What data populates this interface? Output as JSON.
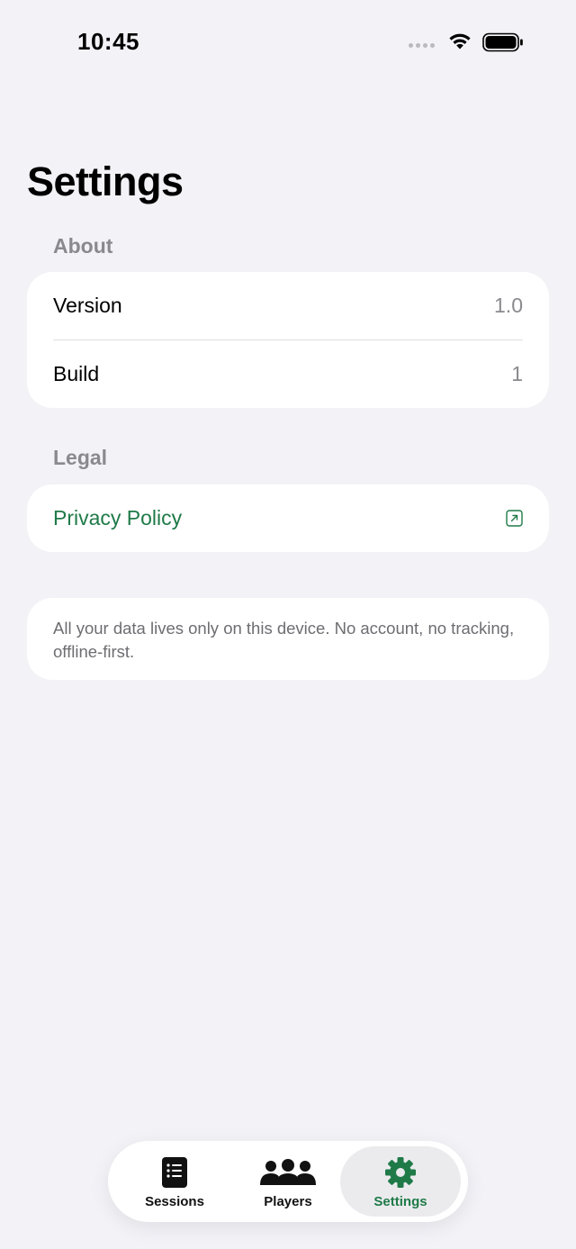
{
  "status_bar": {
    "time": "10:45"
  },
  "title": "Settings",
  "sections": {
    "about": {
      "header": "About",
      "rows": [
        {
          "label": "Version",
          "value": "1.0"
        },
        {
          "label": "Build",
          "value": "1"
        }
      ]
    },
    "legal": {
      "header": "Legal",
      "privacy_label": "Privacy Policy",
      "privacy_icon": "external-link-icon"
    }
  },
  "note": "All your data lives only on this device. No account, no tracking, offline-first.",
  "tabbar": {
    "tabs": [
      {
        "label": "Sessions",
        "icon": "notebook-list-icon"
      },
      {
        "label": "Players",
        "icon": "people-icon"
      },
      {
        "label": "Settings",
        "icon": "gear-icon",
        "active": true
      }
    ]
  },
  "colors": {
    "accent": "#1f7a48",
    "background": "#f2f2f7",
    "secondary_text": "#8a8a8e"
  }
}
